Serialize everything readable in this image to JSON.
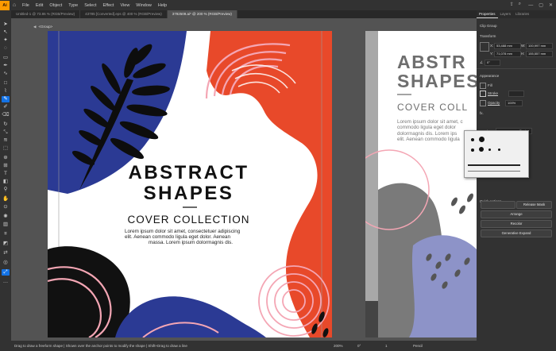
{
  "menu": {
    "app_logo": "Ai",
    "items": [
      "File",
      "Edit",
      "Object",
      "Type",
      "Select",
      "Effect",
      "View",
      "Window",
      "Help"
    ]
  },
  "tabs": [
    {
      "label": "Untitled-1 @ 73.86 % (RGB/Preview)",
      "active": false
    },
    {
      "label": "43785 [Converted].eps @ 400 % (RGB/Preview)",
      "active": false
    },
    {
      "label": "3792509.ai* @ 200 % (RGB/Preview)",
      "active": true
    }
  ],
  "breadcrumb": {
    "label": "<Group>"
  },
  "artboard_left": {
    "title_line1": "ABSTRACT",
    "title_line2": "SHAPES",
    "subtitle": "COVER COLLECTION",
    "body_lines": [
      "Lorem ipsum dolor sit amet, consectetuer adipiscing",
      "elit. Aenean commodo ligula eget dolor. Aenean",
      "massa. Lorem ipsum dolormagnis dis."
    ]
  },
  "artboard_right": {
    "title_line1": "ABSTR",
    "title_line2": "SHAPES",
    "subtitle": "COVER COLL",
    "body_lines": [
      "Lorem ipsum dolor sit amet, c",
      "commodo ligula eget dolor",
      "dolormagnis dis. Lorem ips",
      "elit. Aenean commodo ligula"
    ]
  },
  "panel": {
    "tabs": [
      "Properties",
      "Layers",
      "Libraries"
    ],
    "object_type": "Clip Group",
    "transform_label": "Transform",
    "x_value": "53,488 mm",
    "y_value": "71,078 mm",
    "w_value": "100,997 mm",
    "h_value": "155,557 mm",
    "angle_value": "0°",
    "appearance_label": "Appearance",
    "fill_label": "Fill",
    "stroke_label": "Stroke",
    "opacity_label": "Opacity",
    "opacity_value": "100%",
    "fx_label": "fx.",
    "brush_label": "Brush",
    "brush_value": "Basic",
    "quick_actions_label": "Quick Actions",
    "buttons": [
      "Release Mask",
      "Arrange",
      "Recolor",
      "Generative Expand"
    ]
  },
  "status": {
    "zoom": "200%",
    "angle": "0°",
    "page": "1",
    "tool": "Pencil",
    "hint": "Drag to draw a freeform shape | Shown over the anchor points to modify the shape | Shift+Drag to draw a line"
  },
  "colors": {
    "accent": "#1473e6",
    "navy": "#2b3a94",
    "orange": "#e8492a",
    "pink": "#f4a6b4",
    "gray": "#7a7a7a",
    "periwinkle": "#8d93c8"
  }
}
